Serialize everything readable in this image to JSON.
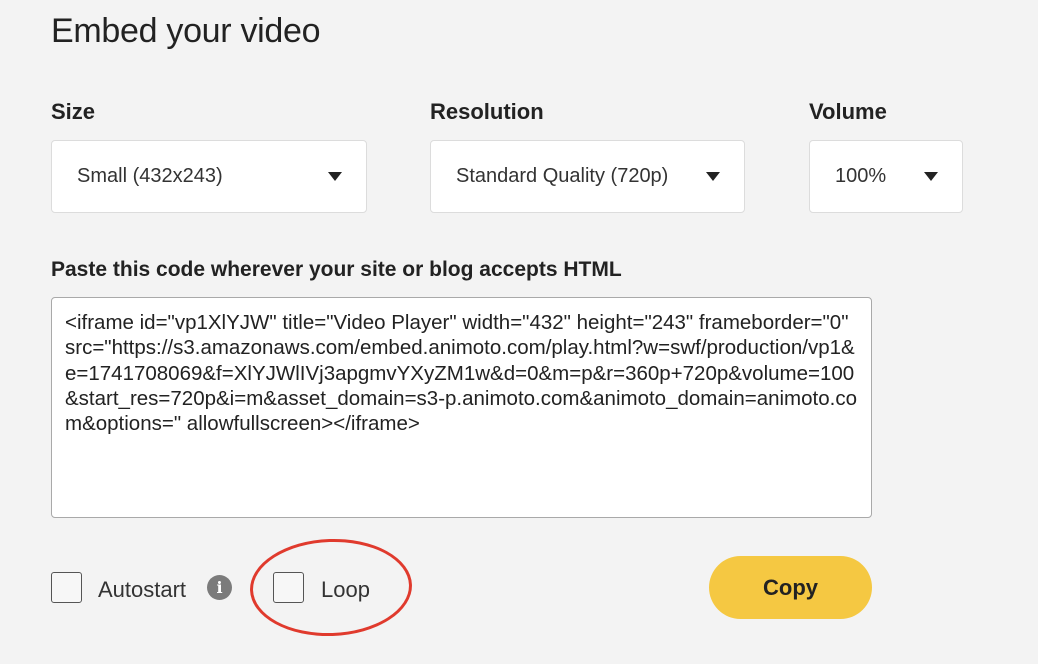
{
  "header": {
    "title": "Embed your video"
  },
  "size": {
    "label": "Size",
    "value": "Small (432x243)"
  },
  "resolution": {
    "label": "Resolution",
    "value": "Standard Quality (720p)"
  },
  "volume": {
    "label": "Volume",
    "value": "100%"
  },
  "embed": {
    "label": "Paste this code wherever your site or blog accepts HTML",
    "code": "<iframe id=\"vp1XlYJW\" title=\"Video Player\" width=\"432\" height=\"243\" frameborder=\"0\" src=\"https://s3.amazonaws.com/embed.animoto.com/play.html?w=swf/production/vp1&e=1741708069&f=XlYJWlIVj3apgmvYXyZM1w&d=0&m=p&r=360p+720p&volume=100&start_res=720p&i=m&asset_domain=s3-p.animoto.com&animoto_domain=animoto.com&options=\" allowfullscreen></iframe>"
  },
  "options": {
    "autostart_label": "Autostart",
    "loop_label": "Loop",
    "info_glyph": "i"
  },
  "actions": {
    "copy_label": "Copy"
  },
  "colors": {
    "accent": "#f5c842",
    "annotation": "#e03a2d"
  }
}
